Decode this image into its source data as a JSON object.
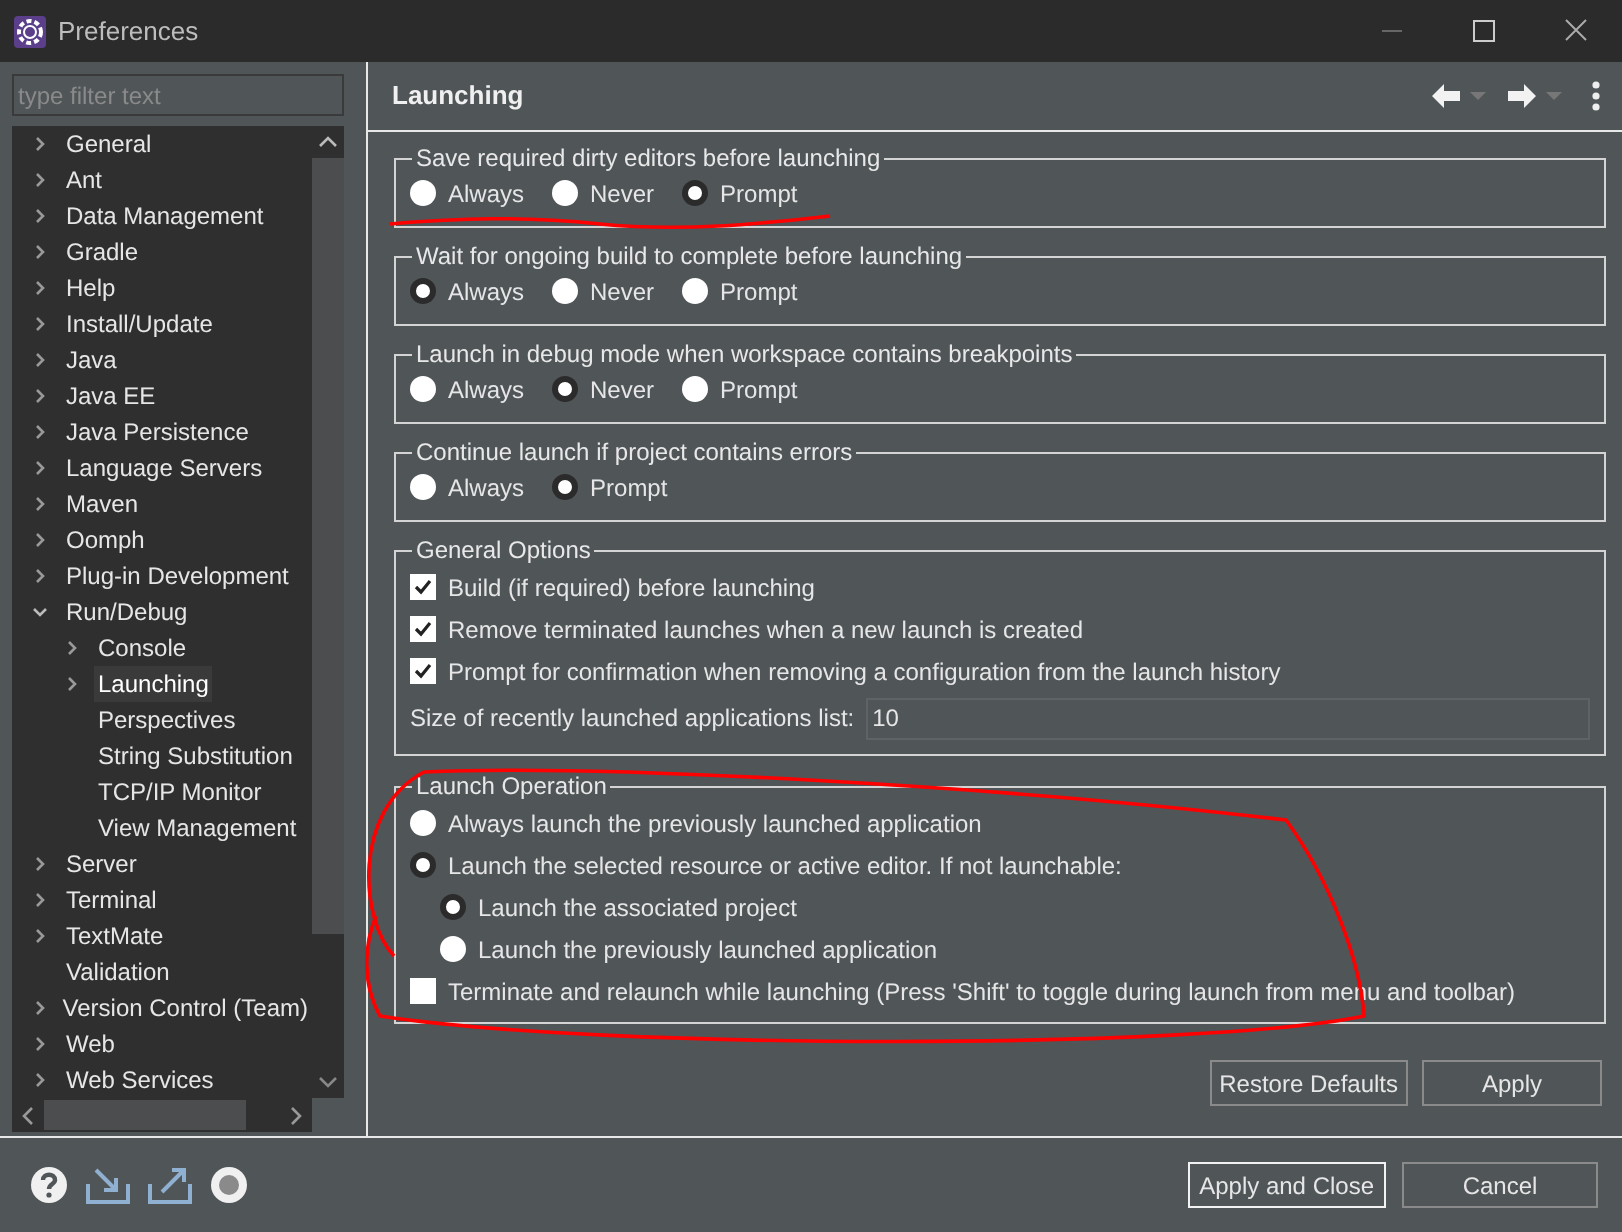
{
  "window": {
    "title": "Preferences"
  },
  "filter": {
    "placeholder": "type filter text"
  },
  "tree": [
    {
      "label": "General",
      "kind": "node",
      "expanded": false,
      "selected": false
    },
    {
      "label": "Ant",
      "kind": "node",
      "expanded": false,
      "selected": false
    },
    {
      "label": "Data Management",
      "kind": "node",
      "expanded": false,
      "selected": false
    },
    {
      "label": "Gradle",
      "kind": "node",
      "expanded": false,
      "selected": false
    },
    {
      "label": "Help",
      "kind": "node",
      "expanded": false,
      "selected": false
    },
    {
      "label": "Install/Update",
      "kind": "node",
      "expanded": false,
      "selected": false
    },
    {
      "label": "Java",
      "kind": "node",
      "expanded": false,
      "selected": false
    },
    {
      "label": "Java EE",
      "kind": "node",
      "expanded": false,
      "selected": false
    },
    {
      "label": "Java Persistence",
      "kind": "node",
      "expanded": false,
      "selected": false
    },
    {
      "label": "Language Servers",
      "kind": "node",
      "expanded": false,
      "selected": false
    },
    {
      "label": "Maven",
      "kind": "node",
      "expanded": false,
      "selected": false
    },
    {
      "label": "Oomph",
      "kind": "node",
      "expanded": false,
      "selected": false
    },
    {
      "label": "Plug-in Development",
      "kind": "node",
      "expanded": false,
      "selected": false
    },
    {
      "label": "Run/Debug",
      "kind": "node",
      "expanded": true,
      "selected": false,
      "children": [
        {
          "label": "Console",
          "kind": "node",
          "expanded": false,
          "selected": false
        },
        {
          "label": "Launching",
          "kind": "node",
          "expanded": false,
          "selected": true
        },
        {
          "label": "Perspectives",
          "kind": "leaf",
          "selected": false
        },
        {
          "label": "String Substitution",
          "kind": "leaf",
          "selected": false
        },
        {
          "label": "TCP/IP Monitor",
          "kind": "leaf",
          "selected": false
        },
        {
          "label": "View Management",
          "kind": "leaf",
          "selected": false
        }
      ]
    },
    {
      "label": "Server",
      "kind": "node",
      "expanded": false,
      "selected": false
    },
    {
      "label": "Terminal",
      "kind": "node",
      "expanded": false,
      "selected": false
    },
    {
      "label": "TextMate",
      "kind": "node",
      "expanded": false,
      "selected": false
    },
    {
      "label": "Validation",
      "kind": "leaf",
      "selected": false
    },
    {
      "label": "Version Control (Team)",
      "kind": "node",
      "expanded": false,
      "selected": false
    },
    {
      "label": "Web",
      "kind": "node",
      "expanded": false,
      "selected": false
    },
    {
      "label": "Web Services",
      "kind": "node",
      "expanded": false,
      "selected": false
    }
  ],
  "page": {
    "title": "Launching"
  },
  "radio_groups": [
    {
      "title": "Save required dirty editors before launching",
      "options": [
        {
          "label": "Always",
          "selected": false
        },
        {
          "label": "Never",
          "selected": false
        },
        {
          "label": "Prompt",
          "selected": true
        }
      ]
    },
    {
      "title": "Wait for ongoing build to complete before launching",
      "options": [
        {
          "label": "Always",
          "selected": true
        },
        {
          "label": "Never",
          "selected": false
        },
        {
          "label": "Prompt",
          "selected": false
        }
      ]
    },
    {
      "title": "Launch in debug mode when workspace contains breakpoints",
      "options": [
        {
          "label": "Always",
          "selected": false
        },
        {
          "label": "Never",
          "selected": true
        },
        {
          "label": "Prompt",
          "selected": false
        }
      ]
    },
    {
      "title": "Continue launch if project contains errors",
      "options": [
        {
          "label": "Always",
          "selected": false
        },
        {
          "label": "Prompt",
          "selected": true
        }
      ]
    }
  ],
  "general_options": {
    "title": "General Options",
    "checkboxes": [
      {
        "label": "Build (if required) before launching",
        "checked": true
      },
      {
        "label": "Remove terminated launches when a new launch is created",
        "checked": true
      },
      {
        "label": "Prompt for confirmation when removing a configuration from the launch history",
        "checked": true
      }
    ],
    "size_label": "Size of recently launched applications list:",
    "size_value": "10"
  },
  "launch_operation": {
    "title": "Launch Operation",
    "items": [
      {
        "kind": "radio",
        "label": "Always launch the previously launched application",
        "selected": false
      },
      {
        "kind": "radio",
        "label": "Launch the selected resource or active editor. If not launchable:",
        "selected": true,
        "children": [
          {
            "kind": "radio",
            "label": "Launch the associated project",
            "selected": true
          },
          {
            "kind": "radio",
            "label": "Launch the previously launched application",
            "selected": false
          }
        ]
      },
      {
        "kind": "checkbox",
        "label": "Terminate and relaunch while launching (Press 'Shift' to toggle during launch from menu and toolbar)",
        "selected": false
      }
    ]
  },
  "page_buttons": [
    "Restore Defaults",
    "Apply"
  ],
  "dialog_buttons": [
    {
      "label": "Apply and Close",
      "focused": true
    },
    {
      "label": "Cancel",
      "focused": false
    }
  ]
}
